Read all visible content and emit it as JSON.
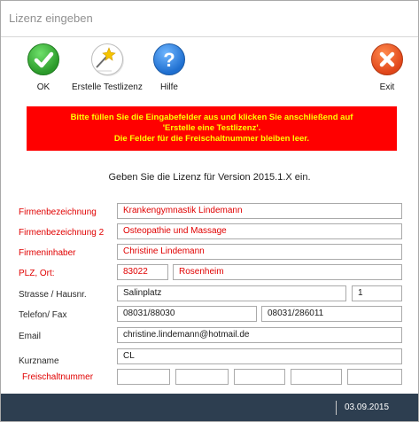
{
  "window": {
    "title": "Lizenz eingeben"
  },
  "toolbar": {
    "ok_label": "OK",
    "testlizenz_label": "Erstelle Testlizenz",
    "hilfe_label": "Hilfe",
    "exit_label": "Exit"
  },
  "notice": {
    "line1": "Bitte füllen Sie die Eingabefelder aus und klicken Sie anschließend auf",
    "line2": "'Erstelle eine Testlizenz'.",
    "line3": "Die Felder für die Freischaltnummer bleiben leer."
  },
  "subtitle": "Geben Sie die Lizenz für Version 2015.1.X ein.",
  "form": {
    "firmenbezeichnung": {
      "label": "Firmenbezeichnung",
      "value": "Krankengymnastik Lindemann"
    },
    "firmenbezeichnung2": {
      "label": "Firmenbezeichnung 2",
      "value": "Osteopathie und Massage"
    },
    "firmeninhaber": {
      "label": "Firmeninhaber",
      "value": "Christine Lindemann"
    },
    "plz_ort": {
      "label": "PLZ, Ort:",
      "plz": "83022",
      "ort": "Rosenheim"
    },
    "strasse": {
      "label": "Strasse / Hausnr.",
      "strasse": "Salinplatz",
      "hausnr": "1"
    },
    "telefon": {
      "label": "Telefon/ Fax",
      "telefon": "08031/88030",
      "fax": "08031/286011"
    },
    "email": {
      "label": "Email",
      "value": "christine.lindemann@hotmail.de"
    },
    "kurzname": {
      "label": "Kurzname",
      "value": "CL"
    },
    "freischalt": {
      "label": "Freischaltnummer",
      "values": [
        "",
        "",
        "",
        "",
        ""
      ]
    }
  },
  "status": {
    "date": "03.09.2015"
  },
  "colors": {
    "notice_bg": "#ff0000",
    "notice_text": "#ffff00",
    "statusbar": "#2d3e50"
  }
}
